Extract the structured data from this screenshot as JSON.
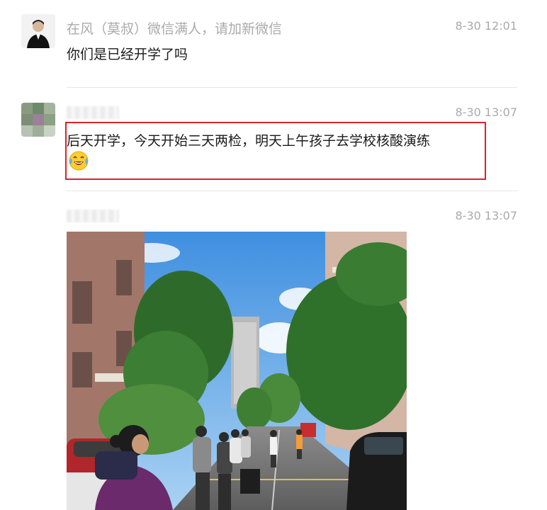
{
  "messages": [
    {
      "sender": "在风（莫叔）微信满人，请加新微信",
      "time": "8-30 12:01",
      "text": "你们是已经开学了吗"
    },
    {
      "sender": "",
      "time": "8-30 13:07",
      "text": "后天开学，今天开始三天两检，明天上午孩子去学校核酸演练",
      "emoji": "laughing-crying-emoji"
    },
    {
      "sender": "",
      "time": "8-30 13:07",
      "image": "street-queue-photo"
    }
  ],
  "colors": {
    "highlight": "#d9232a",
    "meta_text": "#aaaaaa",
    "body_text": "#1a1a1a",
    "divider": "#e6e6e6"
  }
}
